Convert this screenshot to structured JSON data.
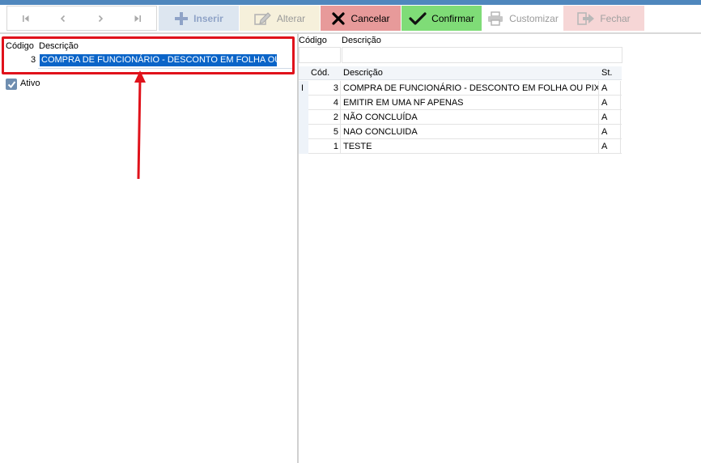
{
  "toolbar": {
    "insert_label": "Inserir",
    "alter_label": "Alterar",
    "cancel_label": "Cancelar",
    "confirm_label": "Confirmar",
    "customize_label": "Customizar",
    "close_label": "Fechar",
    "colors": {
      "insert_bg": "#dde6f0",
      "alter_bg": "#f6f0db",
      "cancel_bg": "#e79a9a",
      "confirm_bg": "#7fdc77",
      "close_bg": "#f6d6d6"
    }
  },
  "form": {
    "codigo_label": "Código",
    "descricao_label": "Descrição",
    "codigo_value": "3",
    "descricao_value": "COMPRA DE FUNCIONÁRIO - DESCONTO EM FOLHA OU PIX",
    "ativo_label": "Ativo"
  },
  "filter": {
    "codigo_label": "Código",
    "descricao_label": "Descrição"
  },
  "grid": {
    "headers": {
      "cod": "Cód.",
      "descricao": "Descrição",
      "st": "St."
    },
    "current_row_marker": "I",
    "rows": [
      {
        "cod": "3",
        "descricao": "COMPRA DE FUNCIONÁRIO - DESCONTO EM FOLHA OU PIX",
        "st": "A"
      },
      {
        "cod": "4",
        "descricao": "EMITIR EM UMA NF APENAS",
        "st": "A"
      },
      {
        "cod": "2",
        "descricao": "NÃO CONCLUÍDA",
        "st": "A"
      },
      {
        "cod": "5",
        "descricao": "NAO CONCLUIDA",
        "st": "A"
      },
      {
        "cod": "1",
        "descricao": "TESTE",
        "st": "A"
      }
    ]
  }
}
